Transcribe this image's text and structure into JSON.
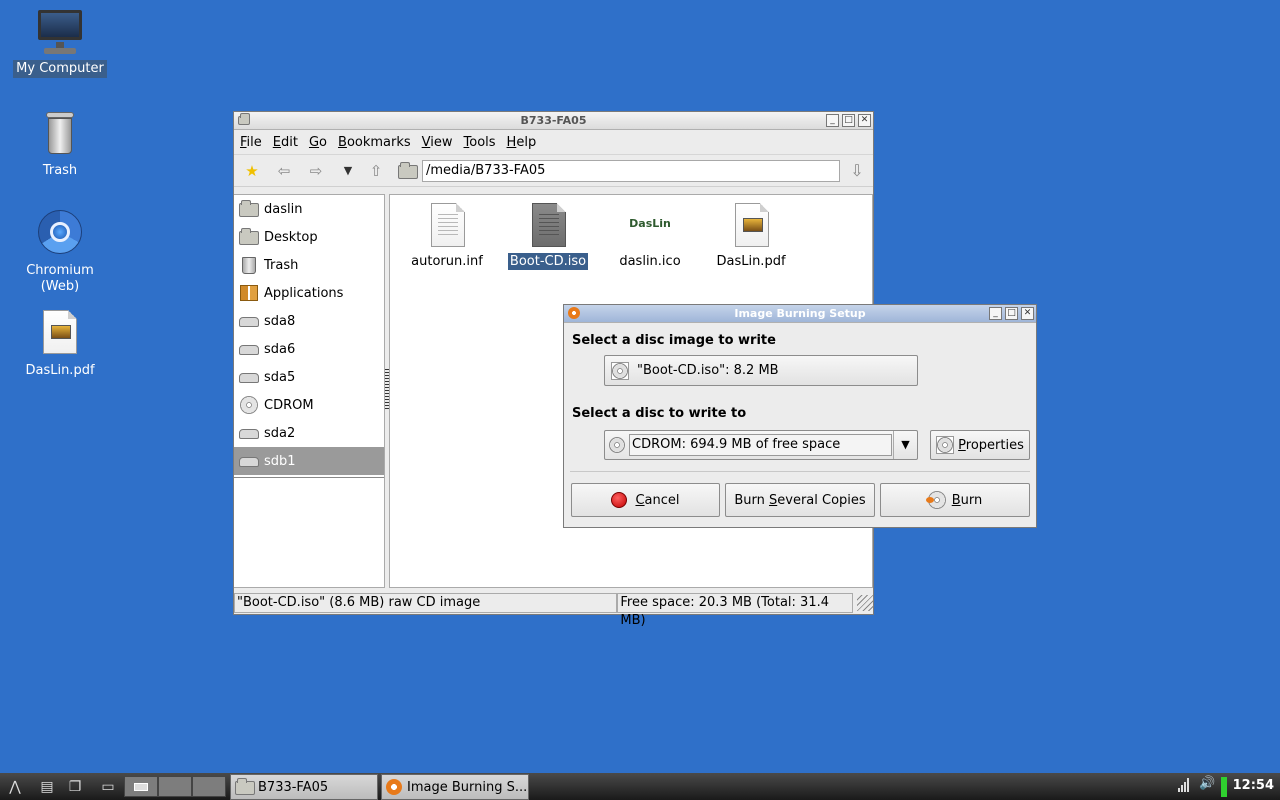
{
  "desktop": {
    "icons": [
      {
        "label": "My Computer"
      },
      {
        "label": "Trash"
      },
      {
        "label": "Chromium\n(Web)"
      },
      {
        "label": "DasLin.pdf"
      }
    ]
  },
  "file_manager": {
    "title": "B733-FA05",
    "menu": [
      "File",
      "Edit",
      "Go",
      "Bookmarks",
      "View",
      "Tools",
      "Help"
    ],
    "menu_mnemonics": [
      "F",
      "E",
      "G",
      "B",
      "V",
      "T",
      "H"
    ],
    "address": "/media/B733-FA05",
    "sidebar": [
      {
        "label": "daslin",
        "icon": "home-folder-icon"
      },
      {
        "label": "Desktop",
        "icon": "desktop-folder-icon"
      },
      {
        "label": "Trash",
        "icon": "trash-icon"
      },
      {
        "label": "Applications",
        "icon": "applications-icon"
      },
      {
        "label": "sda8",
        "icon": "drive-icon"
      },
      {
        "label": "sda6",
        "icon": "drive-icon"
      },
      {
        "label": "sda5",
        "icon": "drive-icon"
      },
      {
        "label": "CDROM",
        "icon": "cdrom-icon"
      },
      {
        "label": "sda2",
        "icon": "drive-icon"
      },
      {
        "label": "sdb1",
        "icon": "drive-icon",
        "active": true
      }
    ],
    "files": [
      {
        "name": "autorun.inf"
      },
      {
        "name": "Boot-CD.iso",
        "selected": true
      },
      {
        "name": "daslin.ico",
        "thumb_text": "DasLin"
      },
      {
        "name": "DasLin.pdf"
      }
    ],
    "status_left": "\"Boot-CD.iso\" (8.6 MB) raw CD image",
    "status_right": "Free space: 20.3 MB (Total: 31.4 MB)"
  },
  "dialog": {
    "title": "Image Burning Setup",
    "select_image_label": "Select a disc image to write",
    "image_button": "\"Boot-CD.iso\": 8.2 MB",
    "select_disc_label": "Select a disc to write to",
    "disc_value": "CDROM: 694.9 MB of free space",
    "properties": "Properties",
    "cancel": "Cancel",
    "burn_several": "Burn Several Copies",
    "burn": "Burn"
  },
  "taskbar": {
    "tasks": [
      "B733-FA05",
      "Image Burning S..."
    ],
    "clock": "12:54"
  },
  "colors": {
    "desktop": "#2f70c9",
    "selection": "#3a5f8c",
    "dialog_title": "#9fb5d8"
  }
}
